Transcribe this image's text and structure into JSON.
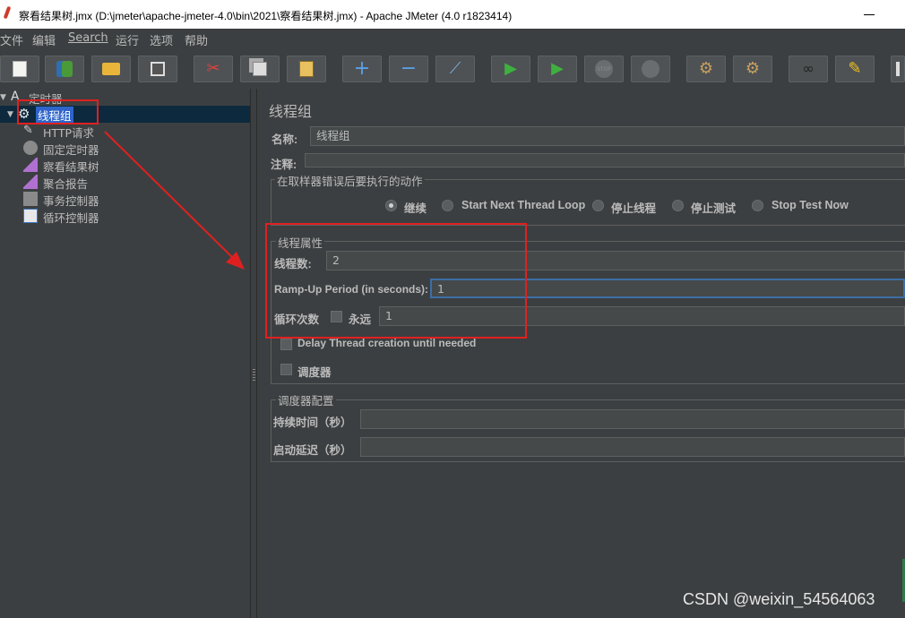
{
  "window": {
    "title": "察看结果树.jmx (D:\\jmeter\\apache-jmeter-4.0\\bin\\2021\\察看结果树.jmx) - Apache JMeter (4.0 r1823414)"
  },
  "menu": [
    "文件",
    "编辑",
    "Search",
    "运行",
    "选项",
    "帮助"
  ],
  "toolbar": {
    "icons": [
      "new-icon",
      "templates-icon",
      "open-icon",
      "save-icon",
      "cut-icon",
      "copy-icon",
      "paste-icon",
      "expand-icon",
      "collapse-icon",
      "toggle-icon",
      "start-icon",
      "start-no-pause-icon",
      "stop-icon",
      "shutdown-icon",
      "clear-icon",
      "clear-all-icon",
      "search-icon",
      "reset-search-icon",
      "more-icon"
    ],
    "stop_label": "STOP"
  },
  "tree": [
    {
      "label": "定时器",
      "icon": "test-plan-icon",
      "level": 0
    },
    {
      "label": "线程组",
      "icon": "thread-group-gear-icon",
      "level": 1,
      "selected": true
    },
    {
      "label": "HTTP请求",
      "icon": "http-sampler-pen-icon",
      "level": 2
    },
    {
      "label": "固定定时器",
      "icon": "timer-clock-icon",
      "level": 2
    },
    {
      "label": "察看结果树",
      "icon": "listener-chart-icon",
      "level": 2
    },
    {
      "label": "聚合报告",
      "icon": "listener-chart-icon",
      "level": 2
    },
    {
      "label": "事务控制器",
      "icon": "controller-icon",
      "level": 2
    },
    {
      "label": "循环控制器",
      "icon": "loop-controller-icon",
      "level": 2
    }
  ],
  "panel": {
    "heading": "线程组",
    "name_label": "名称:",
    "name_value": "线程组",
    "comment_label": "注释:",
    "comment_value": "",
    "error_action": {
      "legend": "在取样器错误后要执行的动作",
      "options": [
        "继续",
        "Start Next Thread Loop",
        "停止线程",
        "停止测试",
        "Stop Test Now"
      ],
      "selected": "继续"
    },
    "thread_props": {
      "legend": "线程属性",
      "threads_label": "线程数:",
      "threads_value": "2",
      "rampup_label": "Ramp-Up Period (in seconds):",
      "rampup_value": "1",
      "loop_label": "循环次数",
      "forever_label": "永远",
      "forever_checked": false,
      "loop_value": "1",
      "delay_label": "Delay Thread creation until needed",
      "delay_checked": false,
      "scheduler_label": "调度器",
      "scheduler_checked": false
    },
    "scheduler_config": {
      "legend": "调度器配置",
      "duration_label": "持续时间（秒）",
      "duration_value": "",
      "delay_label": "启动延迟（秒）",
      "delay_value": ""
    }
  },
  "watermark": "CSDN @weixin_54564063",
  "colors": {
    "background": "#3c3f41",
    "field": "#45494a",
    "selection": "#2f65ca",
    "annotation": "#e02020"
  }
}
